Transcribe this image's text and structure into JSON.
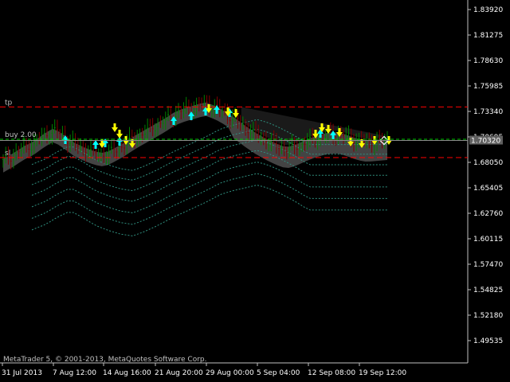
{
  "window": {
    "copyright": "MetaTrader 5, © 2001-2013, MetaQuotes Software Corp."
  },
  "price_axis": {
    "labels": [
      "1.83920",
      "1.81275",
      "1.78630",
      "1.75985",
      "1.73340",
      "1.70695",
      "1.68050",
      "1.65405",
      "1.62760",
      "1.60115",
      "1.57470",
      "1.54825",
      "1.52180",
      "1.49535"
    ],
    "current_price": "1.70320"
  },
  "time_axis": {
    "labels": [
      "31 Jul 2013",
      "7 Aug 12:00",
      "14 Aug 16:00",
      "21 Aug 20:00",
      "29 Aug 00:00",
      "5 Sep 04:00",
      "12 Sep 08:00",
      "19 Sep 12:00"
    ]
  },
  "lines": {
    "tp_label": "tp",
    "buy_label": "buy 2.00",
    "sl_label": "sl"
  },
  "colors": {
    "background": "#000000",
    "axis_text": "#ffffff",
    "tp_line": "#ff0000",
    "sl_line": "#ff0000",
    "buy_line": "#00c000",
    "bull_candle": "#008000",
    "bear_candle": "#800000",
    "arrow_up": "#00ffff",
    "arrow_down": "#ffff00",
    "cloud": "#505050",
    "envelope": "#2f8f7f",
    "current_price_bg": "#606060"
  },
  "chart_data": {
    "type": "line",
    "title": "",
    "series": [
      {
        "values": [
          1.682,
          1.688,
          1.695,
          1.7,
          1.708,
          1.714,
          1.707,
          1.699,
          1.694,
          1.69,
          1.688,
          1.693,
          1.699,
          1.706,
          1.712,
          1.718,
          1.724,
          1.731,
          1.735,
          1.738,
          1.741,
          1.737,
          1.731,
          1.724,
          1.716,
          1.709,
          1.703,
          1.698,
          1.694,
          1.697,
          1.702,
          1.706,
          1.709,
          1.71,
          1.707,
          1.703,
          1.701,
          1.702,
          1.703
        ]
      }
    ],
    "ylim": [
      1.48,
      1.845
    ],
    "y_ticks": [
      1.8392,
      1.81275,
      1.7863,
      1.75985,
      1.7334,
      1.70695,
      1.6805,
      1.65405,
      1.6276,
      1.60115,
      1.5747,
      1.54825,
      1.5218,
      1.49535
    ],
    "tp_level": 1.738,
    "buy_level": 1.7045,
    "sl_level": 1.6855,
    "current_price": 1.7032,
    "grid": false
  }
}
